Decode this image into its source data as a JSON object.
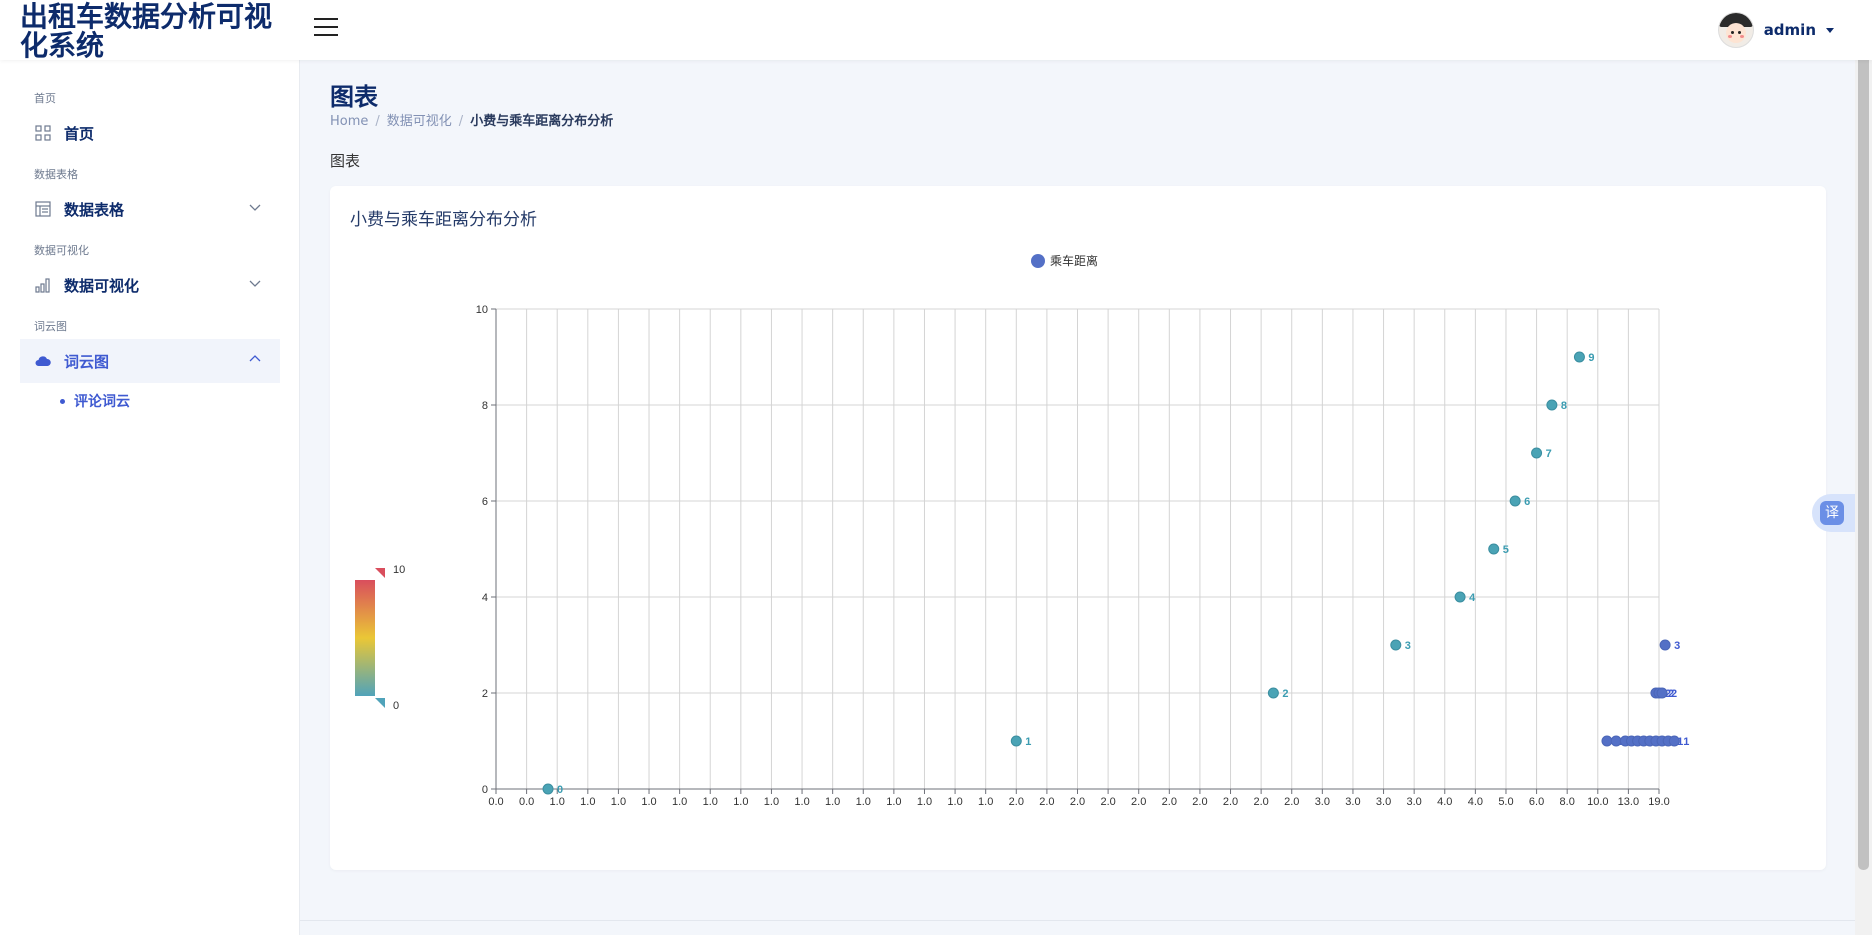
{
  "app": {
    "title": "出租车数据分析可视化系统"
  },
  "user": {
    "name": "admin"
  },
  "sidebar": {
    "sections": [
      {
        "label": "首页",
        "item": "首页"
      },
      {
        "label": "数据表格",
        "item": "数据表格"
      },
      {
        "label": "数据可视化",
        "item": "数据可视化"
      },
      {
        "label": "词云图",
        "item": "词云图"
      }
    ],
    "sub_item": "评论词云"
  },
  "page": {
    "title": "图表",
    "breadcrumb": [
      "Home",
      "数据可视化",
      "小费与乘车距离分布分析"
    ],
    "subtitle": "图表",
    "card_title": "小费与乘车距离分布分析"
  },
  "translate": {
    "label": "译"
  },
  "chart_data": {
    "type": "scatter",
    "title": "",
    "xlabel": "",
    "ylabel": "",
    "ylim": [
      0,
      10
    ],
    "yticks": [
      0,
      2,
      4,
      6,
      8,
      10
    ],
    "grid": true,
    "legend": {
      "position": "top-center",
      "entries": [
        "乘车距离"
      ]
    },
    "visual_map": {
      "min": 0,
      "max": 10,
      "colors": [
        "#50a3ba",
        "#eac736",
        "#d94e5d"
      ]
    },
    "x_categories": [
      "0.0",
      "0.0",
      "1.0",
      "1.0",
      "1.0",
      "1.0",
      "1.0",
      "1.0",
      "1.0",
      "1.0",
      "1.0",
      "1.0",
      "1.0",
      "1.0",
      "1.0",
      "1.0",
      "1.0",
      "2.0",
      "2.0",
      "2.0",
      "2.0",
      "2.0",
      "2.0",
      "2.0",
      "2.0",
      "2.0",
      "2.0",
      "3.0",
      "3.0",
      "3.0",
      "3.0",
      "4.0",
      "4.0",
      "5.0",
      "6.0",
      "8.0",
      "10.0",
      "13.0",
      "19.0"
    ],
    "series": [
      {
        "name": "乘车距离",
        "points": [
          {
            "x": 1.7,
            "y": 0,
            "label": "0"
          },
          {
            "x": 17.0,
            "y": 1,
            "label": "1"
          },
          {
            "x": 25.4,
            "y": 2,
            "label": "2"
          },
          {
            "x": 29.4,
            "y": 3,
            "label": "3"
          },
          {
            "x": 31.5,
            "y": 4,
            "label": "4"
          },
          {
            "x": 32.6,
            "y": 5,
            "label": "5"
          },
          {
            "x": 33.3,
            "y": 6,
            "label": "6"
          },
          {
            "x": 34.0,
            "y": 7,
            "label": "7"
          },
          {
            "x": 34.5,
            "y": 8,
            "label": "8"
          },
          {
            "x": 35.4,
            "y": 9,
            "label": "9"
          },
          {
            "x": 36.3,
            "y": 1,
            "label": "1"
          },
          {
            "x": 36.6,
            "y": 1,
            "label": "1"
          },
          {
            "x": 36.9,
            "y": 1,
            "label": "1"
          },
          {
            "x": 37.1,
            "y": 1,
            "label": "1"
          },
          {
            "x": 37.3,
            "y": 1,
            "label": "1"
          },
          {
            "x": 37.5,
            "y": 1,
            "label": "1"
          },
          {
            "x": 37.7,
            "y": 1,
            "label": "1"
          },
          {
            "x": 37.9,
            "y": 1,
            "label": "1"
          },
          {
            "x": 38.1,
            "y": 1,
            "label": "1"
          },
          {
            "x": 38.3,
            "y": 1,
            "label": "1"
          },
          {
            "x": 38.5,
            "y": 1,
            "label": "1"
          },
          {
            "x": 37.9,
            "y": 2,
            "label": "2"
          },
          {
            "x": 38.0,
            "y": 2,
            "label": "2"
          },
          {
            "x": 38.1,
            "y": 2,
            "label": "2"
          },
          {
            "x": 38.2,
            "y": 3,
            "label": "3"
          }
        ]
      }
    ]
  }
}
